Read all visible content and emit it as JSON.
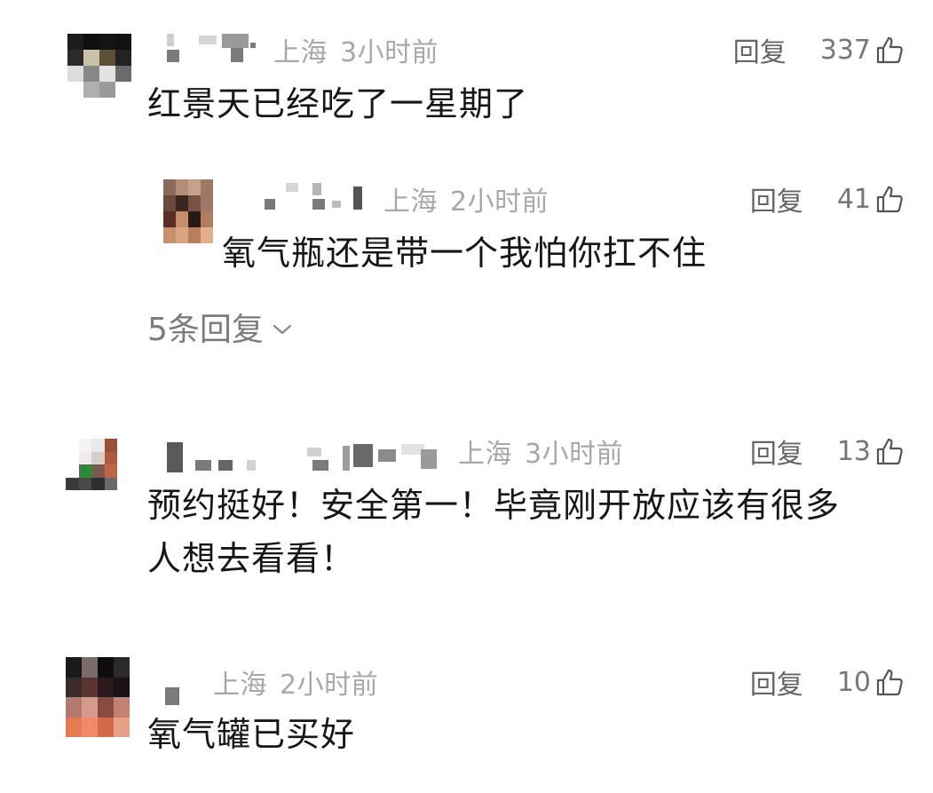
{
  "comments": [
    {
      "location": "上海",
      "time": "3小时前",
      "reply_label": "回复",
      "likes": "337",
      "text": "红景天已经吃了一星期了",
      "reply": {
        "location": "上海",
        "time": "2小时前",
        "reply_label": "回复",
        "likes": "41",
        "text": "氧气瓶还是带一个我怕你扛不住"
      },
      "more_replies": "5条回复"
    },
    {
      "location": "上海",
      "time": "3小时前",
      "reply_label": "回复",
      "likes": "13",
      "text_line1": "预约挺好！安全第一！毕竟刚开放应该有很多",
      "text_line2": "人想去看看！"
    },
    {
      "location": "上海",
      "time": "2小时前",
      "reply_label": "回复",
      "likes": "10",
      "text": "氧气罐已买好"
    }
  ],
  "icons": {
    "like": "thumbs-up-icon",
    "expand": "chevron-down-icon"
  },
  "colors": {
    "meta": "#a8a8a8",
    "text": "#161616",
    "action": "#666666"
  }
}
